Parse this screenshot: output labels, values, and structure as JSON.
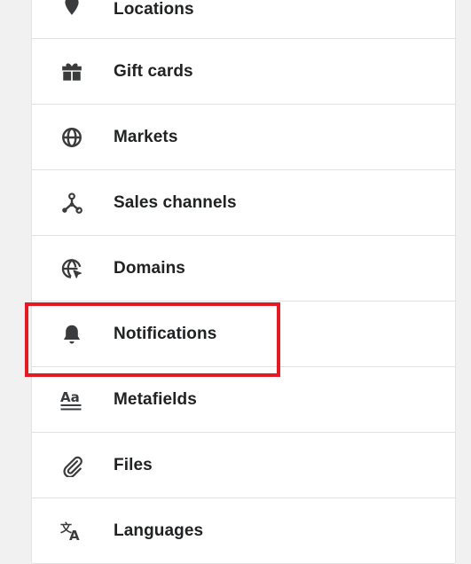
{
  "settings_menu": {
    "items": [
      {
        "label": "Locations",
        "icon": "location-icon"
      },
      {
        "label": "Gift cards",
        "icon": "gift-card-icon"
      },
      {
        "label": "Markets",
        "icon": "globe-icon"
      },
      {
        "label": "Sales channels",
        "icon": "sales-channels-icon"
      },
      {
        "label": "Domains",
        "icon": "domains-icon"
      },
      {
        "label": "Notifications",
        "icon": "bell-icon"
      },
      {
        "label": "Metafields",
        "icon": "metafields-icon"
      },
      {
        "label": "Files",
        "icon": "paperclip-icon"
      },
      {
        "label": "Languages",
        "icon": "translate-icon"
      }
    ],
    "highlighted_item": "Notifications",
    "highlight_color": "#e41a22"
  }
}
